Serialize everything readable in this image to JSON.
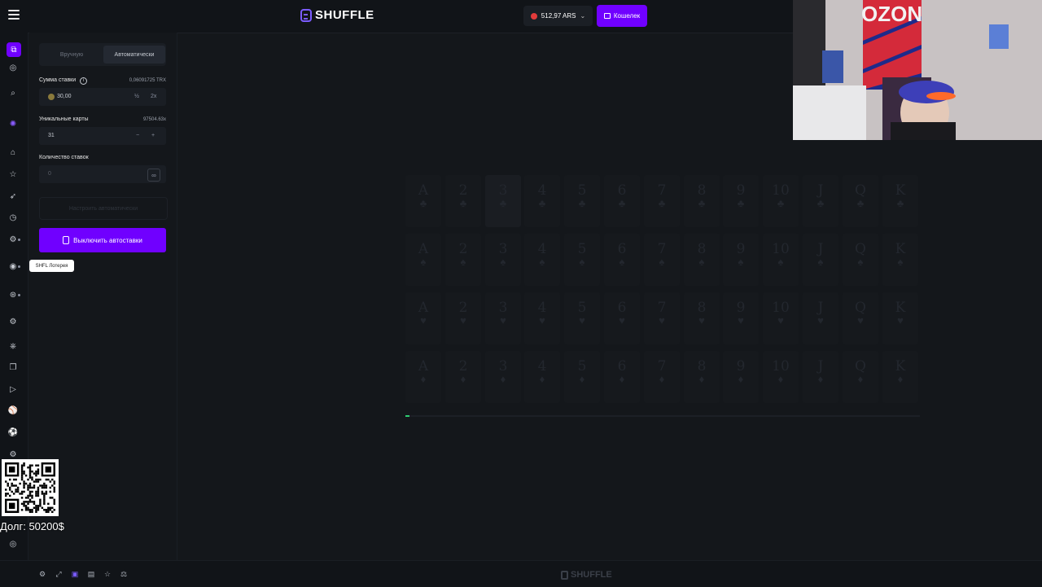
{
  "header": {
    "logo_text": "SHUFFLE",
    "balance": "512,97 ARS",
    "wallet_label": "Кошелек"
  },
  "panel": {
    "tab_manual": "Вручную",
    "tab_auto": "Автоматически",
    "bet_label": "Сумма ставки",
    "bet_converted": "0,06091725 TRX",
    "bet_value": "30,00",
    "half_label": "½",
    "double_label": "2x",
    "cards_label": "Уникальные карты",
    "cards_multiplier": "97504.63x",
    "cards_value": "31",
    "minus_label": "−",
    "plus_label": "+",
    "num_bets_label": "Количество ставок",
    "num_bets_value": "0",
    "infinity_label": "∞",
    "configure_label": "Настроить автоматически",
    "stop_auto_label": "Выключить автоставки"
  },
  "tooltip": "SHFL Лотерея",
  "game": {
    "ranks": [
      "A",
      "2",
      "3",
      "4",
      "5",
      "6",
      "7",
      "8",
      "9",
      "10",
      "J",
      "Q",
      "K"
    ],
    "suits": [
      "♣",
      "♠",
      "♥",
      "♦"
    ],
    "highlighted_card": "3♣",
    "progress": 0.008
  },
  "footer": {
    "logo_text": "SHUFFLE"
  },
  "overlay": {
    "debt_text": "Долг: 50200$",
    "webcam_sign": "OZON"
  },
  "colors": {
    "accent": "#7000ff",
    "background": "#14171b",
    "progress": "#2ecc71"
  }
}
